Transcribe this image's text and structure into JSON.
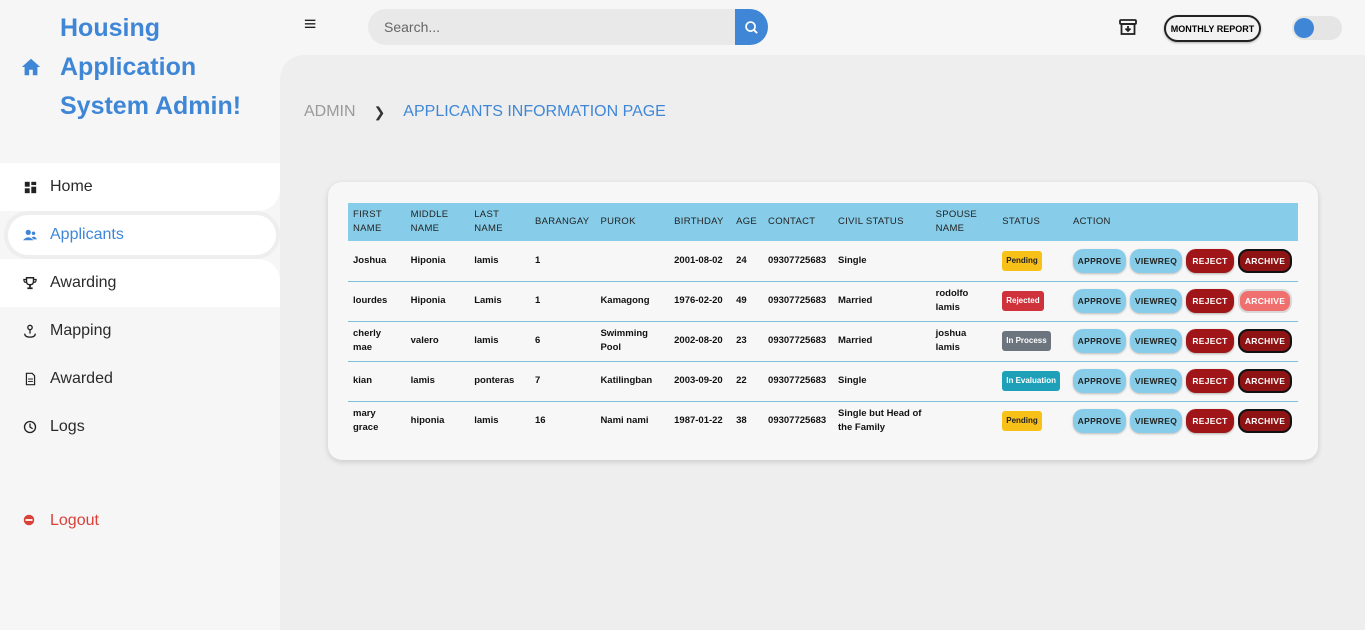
{
  "brand": {
    "title": "Housing Application System Admin!"
  },
  "sidebar": {
    "items": [
      {
        "label": "Home",
        "icon": "dashboard-icon"
      },
      {
        "label": "Applicants",
        "icon": "users-icon"
      },
      {
        "label": "Awarding",
        "icon": "trophy-icon"
      },
      {
        "label": "Mapping",
        "icon": "map-pin-icon"
      },
      {
        "label": "Awarded",
        "icon": "document-icon"
      },
      {
        "label": "Logs",
        "icon": "clock-icon"
      }
    ],
    "logout": "Logout"
  },
  "header": {
    "search_placeholder": "Search...",
    "report_label": "MONTHLY REPORT"
  },
  "breadcrumb": {
    "parent": "ADMIN",
    "current": "APPLICANTS INFORMATION PAGE"
  },
  "table": {
    "headers": [
      "FIRST NAME",
      "MIDDLE NAME",
      "LAST NAME",
      "BARANGAY",
      "PUROK",
      "BIRTHDAY",
      "AGE",
      "CONTACT",
      "CIVIL STATUS",
      "SPOUSE NAME",
      "STATUS",
      "ACTION"
    ],
    "rows": [
      {
        "first": "Joshua",
        "middle": "Hiponia",
        "last": "lamis",
        "barangay": "1",
        "purok": "",
        "birthday": "2001-08-02",
        "age": "24",
        "contact": "09307725683",
        "civil": "Single",
        "spouse": "",
        "status": "Pending",
        "approve": "APPROVE",
        "viewreq": "VIEWREQ",
        "reject": "REJECT",
        "archive": "ARCHIVE"
      },
      {
        "first": "lourdes",
        "middle": "Hiponia",
        "last": "Lamis",
        "barangay": "1",
        "purok": "Kamagong",
        "birthday": "1976-02-20",
        "age": "49",
        "contact": "09307725683",
        "civil": "Married",
        "spouse": "rodolfo lamis",
        "status": "Rejected",
        "approve": "APPROVE",
        "viewreq": "VIEWREQ",
        "reject": "REJECT",
        "archive": "ARCHIVE"
      },
      {
        "first": "cherly mae",
        "middle": "valero",
        "last": "lamis",
        "barangay": "6",
        "purok": "Swimming Pool",
        "birthday": "2002-08-20",
        "age": "23",
        "contact": "09307725683",
        "civil": "Married",
        "spouse": "joshua lamis",
        "status": "In Process",
        "approve": "APPROVE",
        "viewreq": "VIEWREQ",
        "reject": "REJECT",
        "archive": "ARCHIVE"
      },
      {
        "first": "kian",
        "middle": "lamis",
        "last": "ponteras",
        "barangay": "7",
        "purok": "Katilingban",
        "birthday": "2003-09-20",
        "age": "22",
        "contact": "09307725683",
        "civil": "Single",
        "spouse": "",
        "status": "In Evaluation",
        "approve": "APPROVE",
        "viewreq": "VIEWREQ",
        "reject": "REJECT",
        "archive": "ARCHIVE"
      },
      {
        "first": "mary grace",
        "middle": "hiponia",
        "last": "lamis",
        "barangay": "16",
        "purok": "Nami nami",
        "birthday": "1987-01-22",
        "age": "38",
        "contact": "09307725683",
        "civil": "Single but Head of the Family",
        "spouse": "",
        "status": "Pending",
        "approve": "APPROVE",
        "viewreq": "VIEWREQ",
        "reject": "REJECT",
        "archive": "ARCHIVE"
      }
    ]
  },
  "colors": {
    "accent": "#3f87d6",
    "table_header": "#87cde9",
    "reject": "#a01518",
    "logout": "#d9413a"
  }
}
